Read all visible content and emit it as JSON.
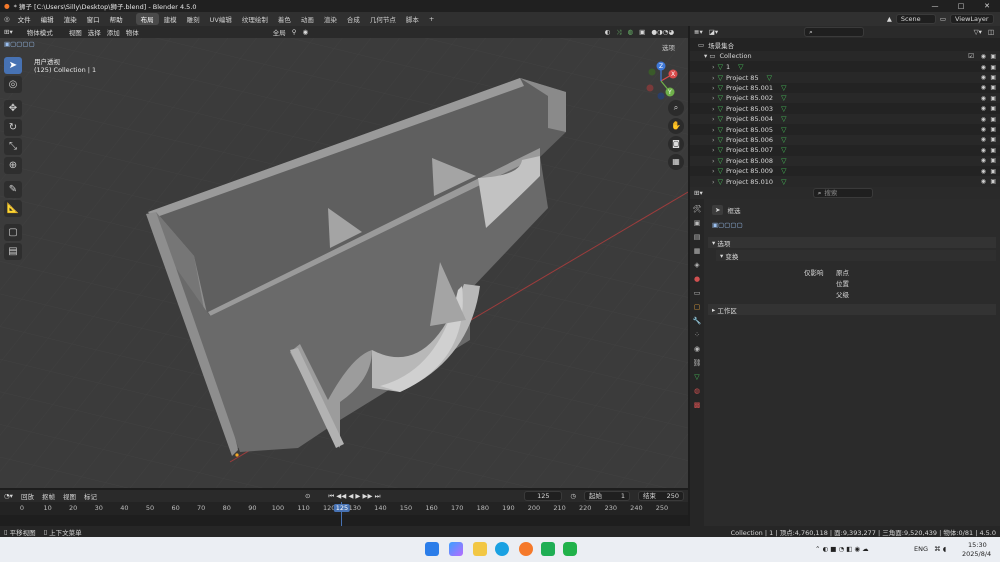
{
  "window": {
    "title": "* 狮子 [C:\\Users\\Silly\\Desktop\\狮子.blend] - Blender 4.5.0",
    "controls": [
      "—",
      "□",
      "✕"
    ]
  },
  "menu": [
    "文件",
    "编辑",
    "渲染",
    "窗口",
    "帮助"
  ],
  "workspaces": [
    "布局",
    "建模",
    "雕刻",
    "UV编辑",
    "纹理绘制",
    "着色",
    "动画",
    "渲染",
    "合成",
    "几何节点",
    "脚本"
  ],
  "active_workspace": "布局",
  "scene_field": "Scene",
  "viewlayer_field": "ViewLayer",
  "viewport": {
    "mode": "物体模式",
    "menus": [
      "视图",
      "选择",
      "添加",
      "物体"
    ],
    "transform": "全局",
    "options_label": "选项",
    "overlay_title": "用户透视",
    "overlay_sub": "(125) Collection | 1",
    "gizmo": {
      "x": "X",
      "y": "Y",
      "z": "Z"
    }
  },
  "outliner": {
    "root": "场景集合",
    "collection": "Collection",
    "items": [
      "1",
      "Project 85",
      "Project 85.001",
      "Project 85.002",
      "Project 85.003",
      "Project 85.004",
      "Project 85.005",
      "Project 85.006",
      "Project 85.007",
      "Project 85.008",
      "Project 85.009",
      "Project 85.010"
    ]
  },
  "properties": {
    "search_placeholder": "搜索",
    "tool_name": "框选",
    "options_label": "选项",
    "transform_label": "变换",
    "affect_only_label": "仅影响",
    "affect_items": [
      "原点",
      "位置",
      "父级"
    ],
    "workspace_label": "工作区"
  },
  "timeline": {
    "menus": [
      "回放",
      "抠帧",
      "视图",
      "标记"
    ],
    "current_frame": "125",
    "start_label": "起始",
    "start": "1",
    "end_label": "结束",
    "end": "250",
    "ticks": [
      "0",
      "10",
      "20",
      "30",
      "40",
      "50",
      "60",
      "70",
      "80",
      "90",
      "100",
      "110",
      "120",
      "125",
      "130",
      "140",
      "150",
      "160",
      "170",
      "180",
      "190",
      "200",
      "210",
      "220",
      "230",
      "240",
      "250"
    ]
  },
  "status": {
    "left1": "平移视图",
    "left2": "上下文菜单",
    "right": "Collection | 1 | 顶点:4,760,118 | 面:9,393,277 | 三角面:9,520,439 | 物体:0/81 | 4.5.0"
  },
  "taskbar": {
    "lang": "ENG",
    "time": "15:30",
    "date": "2025/8/4"
  },
  "colors": {
    "accent": "#4772b3",
    "mesh_tri": "#48c25a",
    "viewport_bg": "#3a3a3a"
  }
}
